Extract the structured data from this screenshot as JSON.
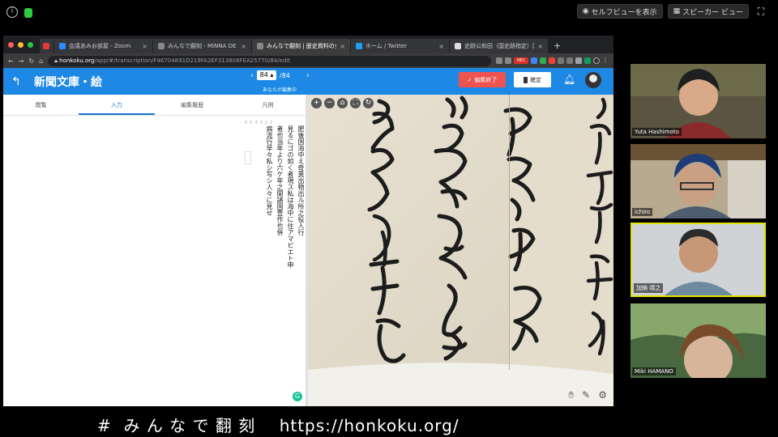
{
  "zoom": {
    "self_view_button": "セルフビューを表示",
    "speaker_view_button": "スピーカー ビュー"
  },
  "browser": {
    "tabs": [
      {
        "title": "会議あみお部屋 - Zoom",
        "active": false
      },
      {
        "title": "みんなで翻刻 - MINNA DE HONKOKU",
        "active": false
      },
      {
        "title": "みんなで翻刻 | 歴史資料の全文翻刻",
        "active": true
      },
      {
        "title": "ホーム / Twitter",
        "active": false
      },
      {
        "title": "史跡公和田（国史跡指定）国分",
        "active": false
      }
    ],
    "url_domain": "honkoku.org",
    "url_path": "/app/#/transcription/F46704891D219FA2EF313808FEA25770/84/edit"
  },
  "app": {
    "title": "新聞文庫・絵",
    "page_current": "84",
    "page_total": "/84",
    "page_note": "あなたが編集中",
    "finish_button": "編集終了",
    "confirm_button": "確定",
    "tabs": [
      "閲覧",
      "入力",
      "編集履歴",
      "凡例"
    ],
    "active_tab": "入力",
    "transcription_lines": [
      "肥後国海中え奇異出物出ル所之役人行",
      "見るにゴの如く者現ス私は海中に住アマビエト申",
      "者也当年より六ケ年之間諸国豊作也併",
      "病流行早々私シ写シ人々に見せ"
    ],
    "ruler": [
      "6",
      "5",
      "4",
      "3",
      "2",
      "1"
    ]
  },
  "participants": [
    {
      "name": "Yuta Hashimoto",
      "speaking": false
    },
    {
      "name": "ichiro",
      "speaking": false
    },
    {
      "name": "加納 靖之",
      "speaking": true
    },
    {
      "name": "Miki HAMANO",
      "speaking": false
    }
  ],
  "banner": "#  み ん な で 翻 刻    https://honkoku.org/"
}
